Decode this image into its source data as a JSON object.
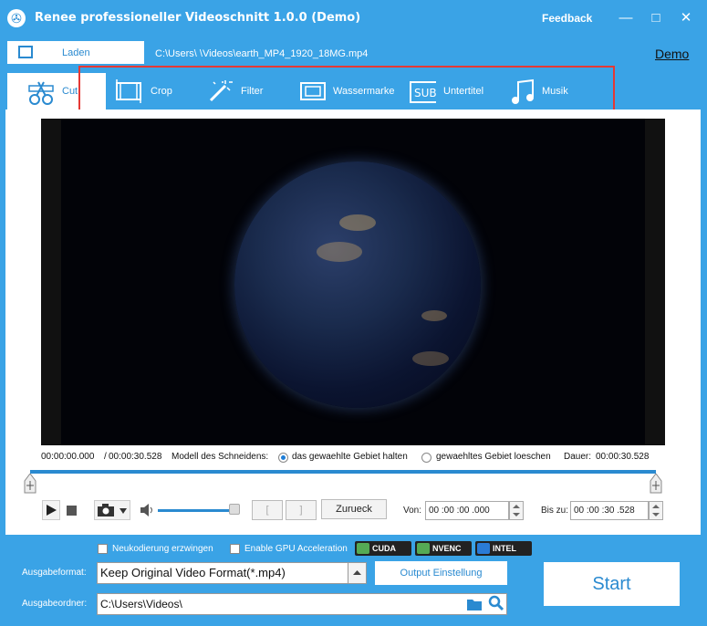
{
  "window": {
    "title": "Renee professioneller Videoschnitt 1.0.0 (Demo)",
    "feedback": "Feedback",
    "minimize": "—",
    "maximize": "□",
    "close": "✕"
  },
  "file": {
    "load_label": "Laden",
    "path": "C:\\Users\\      \\Videos\\earth_MP4_1920_18MG.mp4",
    "demo": "Demo"
  },
  "tabs": [
    {
      "label": "Cut",
      "icon": "scissors-film-icon",
      "active": true
    },
    {
      "label": "Crop",
      "icon": "crop-icon"
    },
    {
      "label": "Filter",
      "icon": "magic-wand-icon"
    },
    {
      "label": "Wassermarke",
      "icon": "watermark-icon"
    },
    {
      "label": "Untertitel",
      "icon": "subtitle-icon"
    },
    {
      "label": "Musik",
      "icon": "music-icon"
    }
  ],
  "cut": {
    "start_time": "00:00:00.000",
    "separator": "/",
    "end_time": "00:00:30.528",
    "mode_label": "Modell des Schneidens:",
    "option_keep": "das gewaehlte Gebiet halten",
    "option_delete": "gewaehltes Gebiet loeschen",
    "duration_label": "Dauer:",
    "duration": "00:00:30.528",
    "selected_mode": "keep"
  },
  "controls": {
    "bracket_open": "[",
    "bracket_close": "]",
    "back_label": "Zurueck",
    "from_label": "Von:",
    "from_value": "00 :00 :00 .000",
    "to_label": "Bis zu:",
    "to_value": "00 :00 :30 .528"
  },
  "output": {
    "force_recode": "Neukodierung erzwingen",
    "gpu_accel": "Enable GPU Acceleration",
    "gpu_badges": [
      "CUDA",
      "NVENC",
      "INTEL"
    ],
    "format_label": "Ausgabeformat:",
    "format_value": "Keep Original Video Format(*.mp4)",
    "settings_button": "Output Einstellung",
    "folder_label": "Ausgabeordner:",
    "folder_value": "C:\\Users\\Videos\\",
    "start_button": "Start"
  },
  "colors": {
    "accent": "#3aa3e6",
    "highlight": "#e53935"
  }
}
